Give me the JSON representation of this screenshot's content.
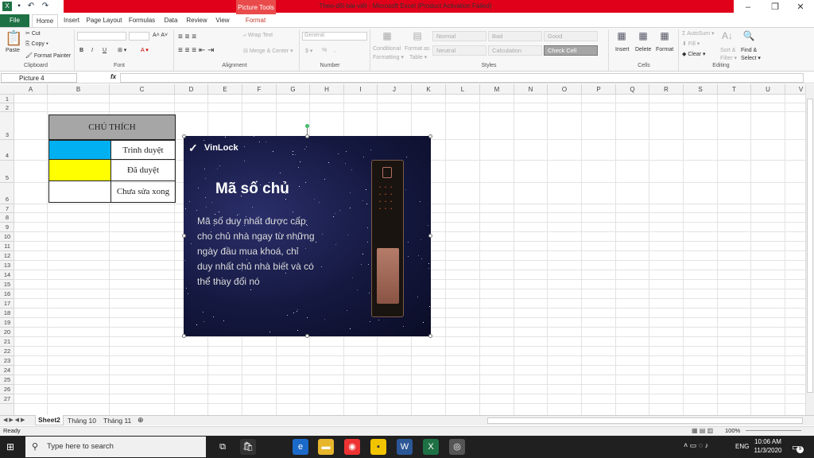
{
  "window": {
    "title": "Theo-dõi-bài-viết  -  Microsoft Excel (Product Activation Failed)",
    "picture_tools": "Picture Tools"
  },
  "tabs": [
    "File",
    "Home",
    "Insert",
    "Page Layout",
    "Formulas",
    "Data",
    "Review",
    "View",
    "Format"
  ],
  "ribbon": {
    "clipboard": {
      "paste": "Paste",
      "cut": "Cut",
      "copy": "Copy ▾",
      "format_painter": "Format Painter",
      "label": "Clipboard"
    },
    "font": {
      "label": "Font",
      "bold": "B",
      "italic": "I",
      "underline": "U"
    },
    "alignment": {
      "wrap": "Wrap Text",
      "merge": "Merge & Center ▾",
      "label": "Alignment"
    },
    "number": {
      "format": "General",
      "currency": "$ ▾",
      "percent": "%",
      "comma": ",",
      "label": "Number"
    },
    "styles": {
      "conditional": "Conditional",
      "formatting": "Formatting ▾",
      "format_as": "Format as",
      "table": "Table ▾",
      "normal": "Normal",
      "bad": "Bad",
      "good": "Good",
      "neutral": "Neutral",
      "calculation": "Calculation",
      "check_cell": "Check Cell",
      "label": "Styles"
    },
    "cells": {
      "insert": "Insert",
      "delete": "Delete",
      "format": "Format",
      "label": "Cells"
    },
    "editing": {
      "autosum": "AutoSum ▾",
      "fill": "Fill ▾",
      "clear": "Clear ▾",
      "sort": "Sort &",
      "filter": "Filter ▾",
      "find": "Find &",
      "select": "Select ▾",
      "label": "Editing"
    }
  },
  "formula_bar": {
    "name_box": "Picture 4",
    "fx": "fx"
  },
  "columns": [
    "A",
    "B",
    "C",
    "D",
    "E",
    "F",
    "G",
    "H",
    "I",
    "J",
    "K",
    "L",
    "M",
    "N",
    "O",
    "P",
    "Q",
    "R",
    "S",
    "T",
    "U",
    "V"
  ],
  "rows": [
    "1",
    "2",
    "3",
    "4",
    "5",
    "6",
    "7",
    "8",
    "9",
    "10",
    "11",
    "12",
    "13",
    "14",
    "15",
    "16",
    "17",
    "18",
    "19",
    "20",
    "21",
    "22",
    "23",
    "24",
    "25",
    "26",
    "27"
  ],
  "legend": {
    "header": "CHÚ THÍCH",
    "rows": [
      {
        "color": "#00b0f0",
        "label": "Trình duyệt"
      },
      {
        "color": "#ffff00",
        "label": "Đã duyệt"
      },
      {
        "color": "#ffffff",
        "label": "Chưa sửa xong"
      }
    ]
  },
  "picture": {
    "brand": "VinLock",
    "title": "Mã số chủ",
    "body_lines": [
      "Mã số duy nhất được cấp",
      "cho chủ nhà ngay từ những",
      "ngày đầu mua khoá, chỉ",
      "duy nhất chủ nhà biết và có",
      "thể thay đổi nó"
    ]
  },
  "sheets": {
    "active": "Sheet2",
    "others": [
      "Tháng 10",
      "Tháng 11"
    ]
  },
  "status": {
    "ready": "Ready",
    "zoom": "100%"
  },
  "taskbar": {
    "search_placeholder": "Type here to search",
    "time": "10:06 AM",
    "date": "11/3/2020",
    "lang": "ENG",
    "notif_count": "9"
  }
}
